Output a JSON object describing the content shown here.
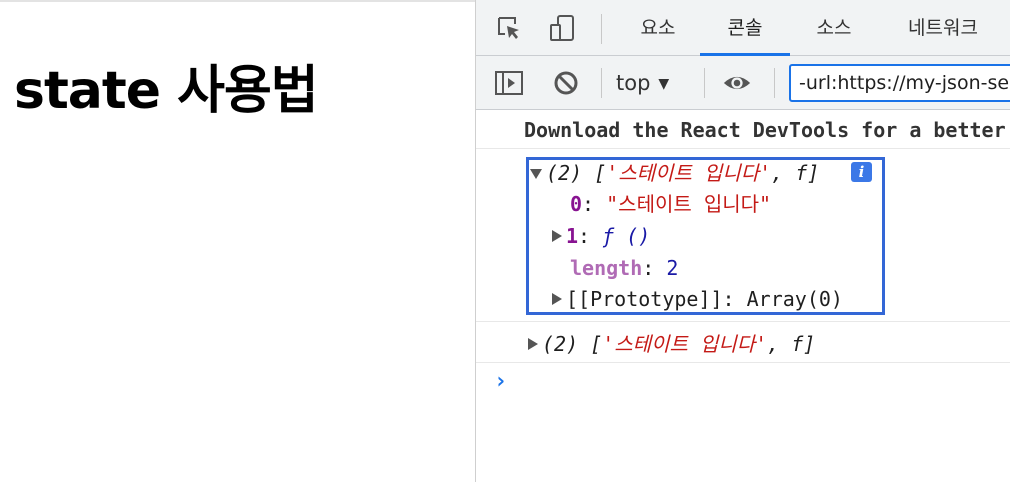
{
  "page": {
    "title": "state 사용법"
  },
  "devtools": {
    "tabs": [
      {
        "label": "요소",
        "active": false
      },
      {
        "label": "콘솔",
        "active": true
      },
      {
        "label": "소스",
        "active": false
      },
      {
        "label": "네트워크",
        "active": false
      }
    ],
    "toolbar": {
      "context": "top",
      "filter_value": "-url:https://my-json-server"
    },
    "accent_color": "#1a73e8"
  },
  "console": {
    "devtools_notice": "Download the React DevTools for a better development experience",
    "expanded_array": {
      "summary_count": "(2)",
      "summary_open": "[",
      "summary_str": "'스테이트 입니다'",
      "summary_sep": ", ",
      "summary_fn": "f",
      "summary_close": "]",
      "info_badge": "i",
      "entries": [
        {
          "key": "0",
          "sep": ": ",
          "value": "\"스테이트 입니다\""
        },
        {
          "key": "1",
          "sep": ": ",
          "value": "ƒ ()"
        },
        {
          "key": "length",
          "sep": ": ",
          "value": "2"
        },
        {
          "key": "[[Prototype]]",
          "sep": ": ",
          "value": "Array(0)"
        }
      ]
    },
    "collapsed_array": {
      "count": "(2)",
      "open": "[",
      "str": "'스테이트 입니다'",
      "sep": ", ",
      "fn": "f",
      "close": "]"
    },
    "prompt": "›"
  }
}
